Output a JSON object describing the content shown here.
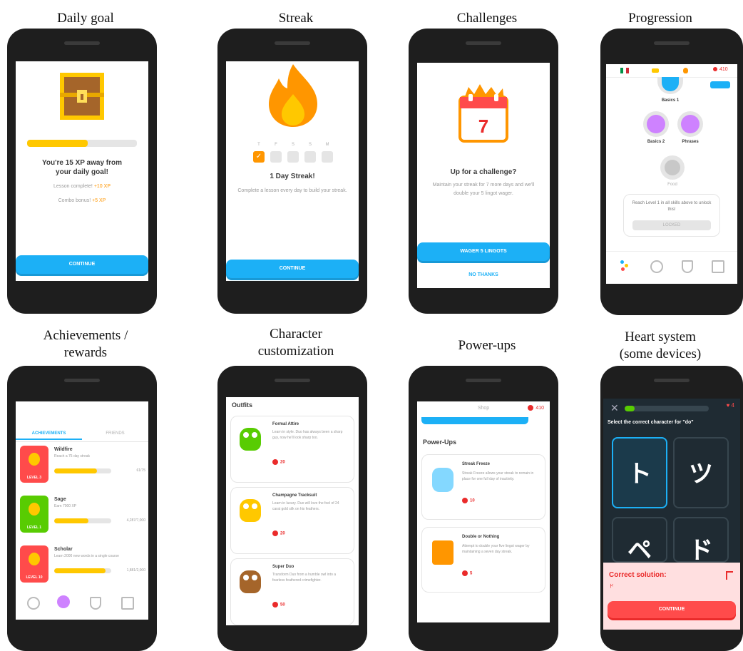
{
  "captions": {
    "daily_goal": "Daily goal",
    "streak": "Streak",
    "challenges": "Challenges",
    "progression": "Progression",
    "achievements_l1": "Achievements /",
    "achievements_l2": "rewards",
    "character_l1": "Character",
    "character_l2": "customization",
    "powerups": "Power-ups",
    "heart_l1": "Heart system",
    "heart_l2": "(some devices)"
  },
  "daily_goal": {
    "heading_l1": "You're 15 XP away from",
    "heading_l2": "your daily goal!",
    "lesson_label": "Lesson complete!",
    "lesson_value": "+10 XP",
    "combo_label": "Combo bonus!",
    "combo_value": "+5 XP",
    "progress": 0.55,
    "continue": "CONTINUE"
  },
  "streak": {
    "days": [
      "T",
      "F",
      "S",
      "S",
      "M"
    ],
    "title": "1 Day Streak!",
    "desc": "Complete a lesson every day to build your streak.",
    "continue": "CONTINUE"
  },
  "challenges": {
    "calendar_number": "7",
    "title": "Up for a challenge?",
    "desc": "Maintain your streak for 7 more days and we'll double your 5 lingot wager.",
    "wager": "WAGER 5 LINGOTS",
    "no_thanks": "NO THANKS"
  },
  "progression": {
    "skill_top": "Basics 1",
    "skill_left": "Basics 2",
    "skill_right": "Phrases",
    "skill_locked": "Food",
    "notice": "Reach Level 1 in all skills above to unlock this!",
    "button": "LOCKED",
    "gems": "410"
  },
  "achievements": {
    "tab_active": "ACHIEVEMENTS",
    "tab_other": "FRIENDS",
    "items": [
      {
        "title": "Wildfire",
        "desc": "Reach a 75 day streak",
        "level": "LEVEL 3",
        "progress": 0.75,
        "count": "61/75"
      },
      {
        "title": "Sage",
        "desc": "Earn 7000 XP",
        "level": "LEVEL 1",
        "progress": 0.6,
        "count": "4,287/7,000"
      },
      {
        "title": "Scholar",
        "desc": "Learn 2000 new words in a single course",
        "level": "LEVEL 10",
        "progress": 0.9,
        "count": "1,881/2,000"
      }
    ]
  },
  "character": {
    "header": "Outfits",
    "items": [
      {
        "title": "Formal Attire",
        "desc": "Learn in style. Duo has always been a sharp guy, now he'll look sharp too.",
        "price": "20"
      },
      {
        "title": "Champagne Tracksuit",
        "desc": "Learn in luxury. Duo will love the feel of 24 carat gold silk on his feathers.",
        "price": "20"
      },
      {
        "title": "Super Duo",
        "desc": "Transform Duo from a humble owl into a fearless feathered crimefighter.",
        "price": "50"
      }
    ]
  },
  "powerups": {
    "top_tab": "Shop",
    "gems": "410",
    "header": "Power-Ups",
    "items": [
      {
        "title": "Streak Freeze",
        "desc": "Streak Freeze allows your streak to remain in place for one full day of inactivity.",
        "price": "10"
      },
      {
        "title": "Double or Nothing",
        "desc": "Attempt to double your five lingot wager by maintaining a seven day streak.",
        "price": "5"
      }
    ]
  },
  "heart": {
    "hearts": "4",
    "prompt": "Select the correct character for \"do\"",
    "choices": [
      "ト",
      "ツ",
      "ペ",
      "ド"
    ],
    "correct_label": "Correct solution:",
    "answer": "ド",
    "continue": "CONTINUE"
  },
  "colors": {
    "blue": "#1cb0f6",
    "yellow": "#ffc800",
    "orange": "#ff9600",
    "red": "#ff4b4b",
    "dark": "#1f2b33"
  }
}
